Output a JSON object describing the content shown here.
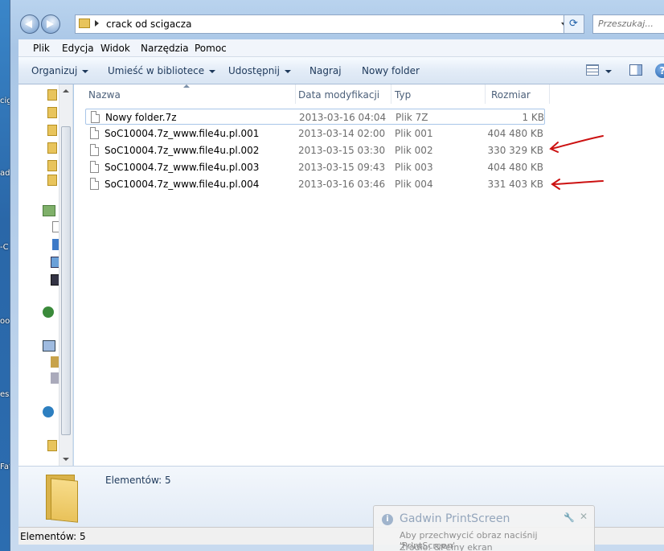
{
  "address": {
    "path": "crack od scigacza"
  },
  "search": {
    "placeholder": "Przeszukaj..."
  },
  "menu": [
    "Plik",
    "Edycja",
    "Widok",
    "Narzędzia",
    "Pomoc"
  ],
  "toolbar": {
    "organize": "Organizuj",
    "library": "Umieść w bibliotece",
    "share": "Udostępnij",
    "burn": "Nagraj",
    "new_folder": "Nowy folder",
    "help_glyph": "?"
  },
  "columns": {
    "name": "Nazwa",
    "date": "Data modyfikacji",
    "type": "Typ",
    "size": "Rozmiar"
  },
  "files": [
    {
      "name": "Nowy folder.7z",
      "date": "2013-03-16 04:04",
      "type": "Plik 7Z",
      "size": "1 KB"
    },
    {
      "name": "SoC10004.7z_www.file4u.pl.001",
      "date": "2013-03-14 02:00",
      "type": "Plik 001",
      "size": "404 480 KB"
    },
    {
      "name": "SoC10004.7z_www.file4u.pl.002",
      "date": "2013-03-15 03:30",
      "type": "Plik 002",
      "size": "330 329 KB"
    },
    {
      "name": "SoC10004.7z_www.file4u.pl.003",
      "date": "2013-03-15 09:43",
      "type": "Plik 003",
      "size": "404 480 KB"
    },
    {
      "name": "SoC10004.7z_www.file4u.pl.004",
      "date": "2013-03-16 03:46",
      "type": "Plik 004",
      "size": "331 403 KB"
    }
  ],
  "details": {
    "count": "Elementów: 5"
  },
  "status": {
    "text": "Elementów: 5"
  },
  "toast": {
    "title": "Gadwin PrintScreen",
    "line1": "Aby przechwycić obraz naciśnij 'PrintScreen'",
    "line2": "Źródło:  &Pełny ekran"
  },
  "desktop": {
    "frag1": "cig",
    "frag2": "ad",
    "frag3": "-C",
    "frag4": "oo",
    "frag5": "esz",
    "frag6": "Fat"
  },
  "colors": {
    "annotation_arrow": "#cc1111",
    "toolbar_text": "#1e395b"
  }
}
